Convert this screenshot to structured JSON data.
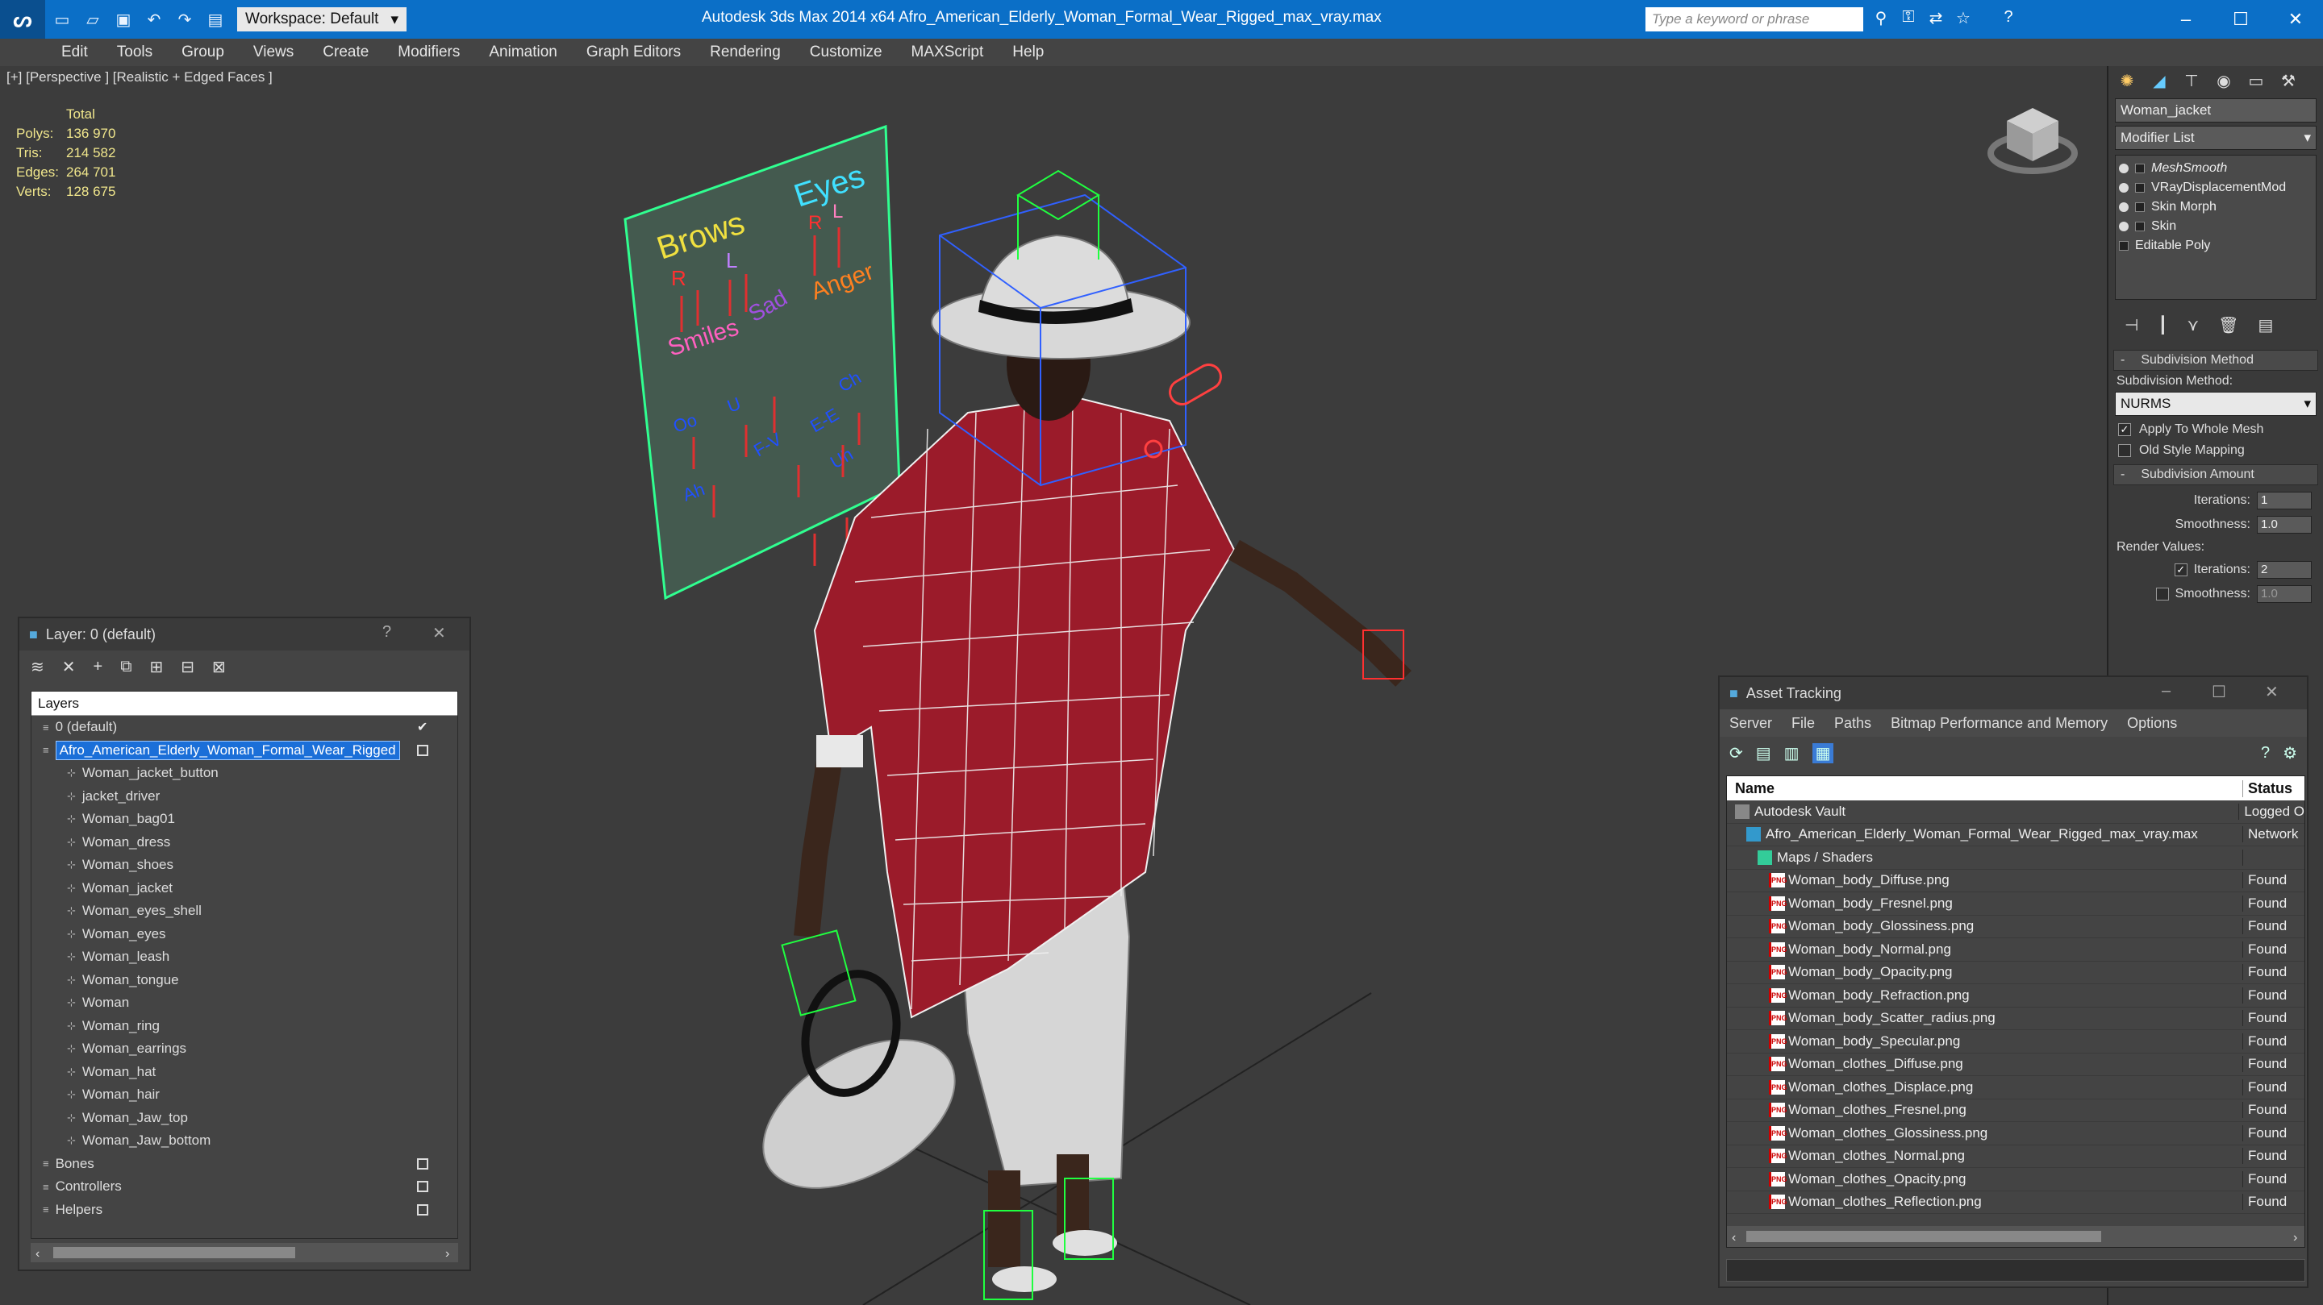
{
  "titlebar": {
    "title": "Autodesk 3ds Max  2014 x64      Afro_American_Elderly_Woman_Formal_Wear_Rigged_max_vray.max",
    "workspace": "Workspace: Default",
    "search_placeholder": "Type a keyword or phrase"
  },
  "menu": [
    "Edit",
    "Tools",
    "Group",
    "Views",
    "Create",
    "Modifiers",
    "Animation",
    "Graph Editors",
    "Rendering",
    "Customize",
    "MAXScript",
    "Help"
  ],
  "viewport": {
    "label": "[+] [Perspective ] [Realistic + Edged Faces ]",
    "stats_header": "Total",
    "stats": [
      {
        "k": "Polys:",
        "v": "136 970"
      },
      {
        "k": "Tris:",
        "v": "214 582"
      },
      {
        "k": "Edges:",
        "v": "264 701"
      },
      {
        "k": "Verts:",
        "v": "128 675"
      }
    ],
    "board": {
      "brows": "Brows",
      "eyes": "Eyes",
      "r": "R",
      "l": "L",
      "smiles": "Smiles",
      "anger": "Anger",
      "sad": "Sad",
      "ah": "Ah",
      "uh": "Uh",
      "oo": "Oo",
      "ee": "E-E",
      "u": "U",
      "ch": "Ch",
      "fv": "F-V"
    }
  },
  "command_panel": {
    "object_name": "Woman_jacket",
    "modifier_list": "Modifier List",
    "stack": [
      "MeshSmooth",
      "VRayDisplacementMod",
      "Skin Morph",
      "Skin",
      "Editable Poly"
    ],
    "subdivision_method_header": "Subdivision Method",
    "subdivision_method_label": "Subdivision Method:",
    "subdivision_method_value": "NURMS",
    "apply_whole_mesh": "Apply To Whole Mesh",
    "old_style_mapping": "Old Style Mapping",
    "subdivision_amount_header": "Subdivision Amount",
    "iterations_label": "Iterations:",
    "iterations_value": "1",
    "smoothness_label": "Smoothness:",
    "smoothness_value": "1.0",
    "render_values_label": "Render Values:",
    "render_iterations_value": "2",
    "render_smoothness_value": "1.0"
  },
  "layer_dialog": {
    "title": "Layer: 0 (default)",
    "help": "?",
    "list_header": "Layers",
    "layers": [
      {
        "name": "0 (default)",
        "level": 1,
        "check": "tick"
      },
      {
        "name": "Afro_American_Elderly_Woman_Formal_Wear_Rigged",
        "level": 1,
        "check": "box",
        "selected": true
      },
      {
        "name": "Woman_jacket_button",
        "level": 2
      },
      {
        "name": "jacket_driver",
        "level": 2
      },
      {
        "name": "Woman_bag01",
        "level": 2
      },
      {
        "name": "Woman_dress",
        "level": 2
      },
      {
        "name": "Woman_shoes",
        "level": 2
      },
      {
        "name": "Woman_jacket",
        "level": 2
      },
      {
        "name": "Woman_eyes_shell",
        "level": 2
      },
      {
        "name": "Woman_eyes",
        "level": 2
      },
      {
        "name": "Woman_leash",
        "level": 2
      },
      {
        "name": "Woman_tongue",
        "level": 2
      },
      {
        "name": "Woman",
        "level": 2
      },
      {
        "name": "Woman_ring",
        "level": 2
      },
      {
        "name": "Woman_earrings",
        "level": 2
      },
      {
        "name": "Woman_hat",
        "level": 2
      },
      {
        "name": "Woman_hair",
        "level": 2
      },
      {
        "name": "Woman_Jaw_top",
        "level": 2
      },
      {
        "name": "Woman_Jaw_bottom",
        "level": 2
      },
      {
        "name": "Bones",
        "level": 1,
        "check": "box"
      },
      {
        "name": "Controllers",
        "level": 1,
        "check": "box"
      },
      {
        "name": "Helpers",
        "level": 1,
        "check": "box"
      }
    ]
  },
  "asset_tracking": {
    "title": "Asset Tracking",
    "menu": [
      "Server",
      "File",
      "Paths",
      "Bitmap Performance and Memory",
      "Options"
    ],
    "col_name": "Name",
    "col_status": "Status",
    "rows": [
      {
        "name": "Autodesk Vault",
        "status": "Logged O",
        "level": 0,
        "icon": "vault"
      },
      {
        "name": "Afro_American_Elderly_Woman_Formal_Wear_Rigged_max_vray.max",
        "status": "Network",
        "level": 1,
        "icon": "max"
      },
      {
        "name": "Maps / Shaders",
        "status": "",
        "level": 2,
        "icon": "maps"
      },
      {
        "name": "Woman_body_Diffuse.png",
        "status": "Found",
        "level": 3,
        "icon": "png"
      },
      {
        "name": "Woman_body_Fresnel.png",
        "status": "Found",
        "level": 3,
        "icon": "png"
      },
      {
        "name": "Woman_body_Glossiness.png",
        "status": "Found",
        "level": 3,
        "icon": "png"
      },
      {
        "name": "Woman_body_Normal.png",
        "status": "Found",
        "level": 3,
        "icon": "png"
      },
      {
        "name": "Woman_body_Opacity.png",
        "status": "Found",
        "level": 3,
        "icon": "png"
      },
      {
        "name": "Woman_body_Refraction.png",
        "status": "Found",
        "level": 3,
        "icon": "png"
      },
      {
        "name": "Woman_body_Scatter_radius.png",
        "status": "Found",
        "level": 3,
        "icon": "png"
      },
      {
        "name": "Woman_body_Specular.png",
        "status": "Found",
        "level": 3,
        "icon": "png"
      },
      {
        "name": "Woman_clothes_Diffuse.png",
        "status": "Found",
        "level": 3,
        "icon": "png"
      },
      {
        "name": "Woman_clothes_Displace.png",
        "status": "Found",
        "level": 3,
        "icon": "png"
      },
      {
        "name": "Woman_clothes_Fresnel.png",
        "status": "Found",
        "level": 3,
        "icon": "png"
      },
      {
        "name": "Woman_clothes_Glossiness.png",
        "status": "Found",
        "level": 3,
        "icon": "png"
      },
      {
        "name": "Woman_clothes_Normal.png",
        "status": "Found",
        "level": 3,
        "icon": "png"
      },
      {
        "name": "Woman_clothes_Opacity.png",
        "status": "Found",
        "level": 3,
        "icon": "png"
      },
      {
        "name": "Woman_clothes_Reflection.png",
        "status": "Found",
        "level": 3,
        "icon": "png"
      }
    ]
  },
  "colors": {
    "titlebar": "#0b6fc7",
    "selection": "#1b6fd8",
    "stats": "#f0e68c",
    "jacket": "#9b1b2a"
  }
}
